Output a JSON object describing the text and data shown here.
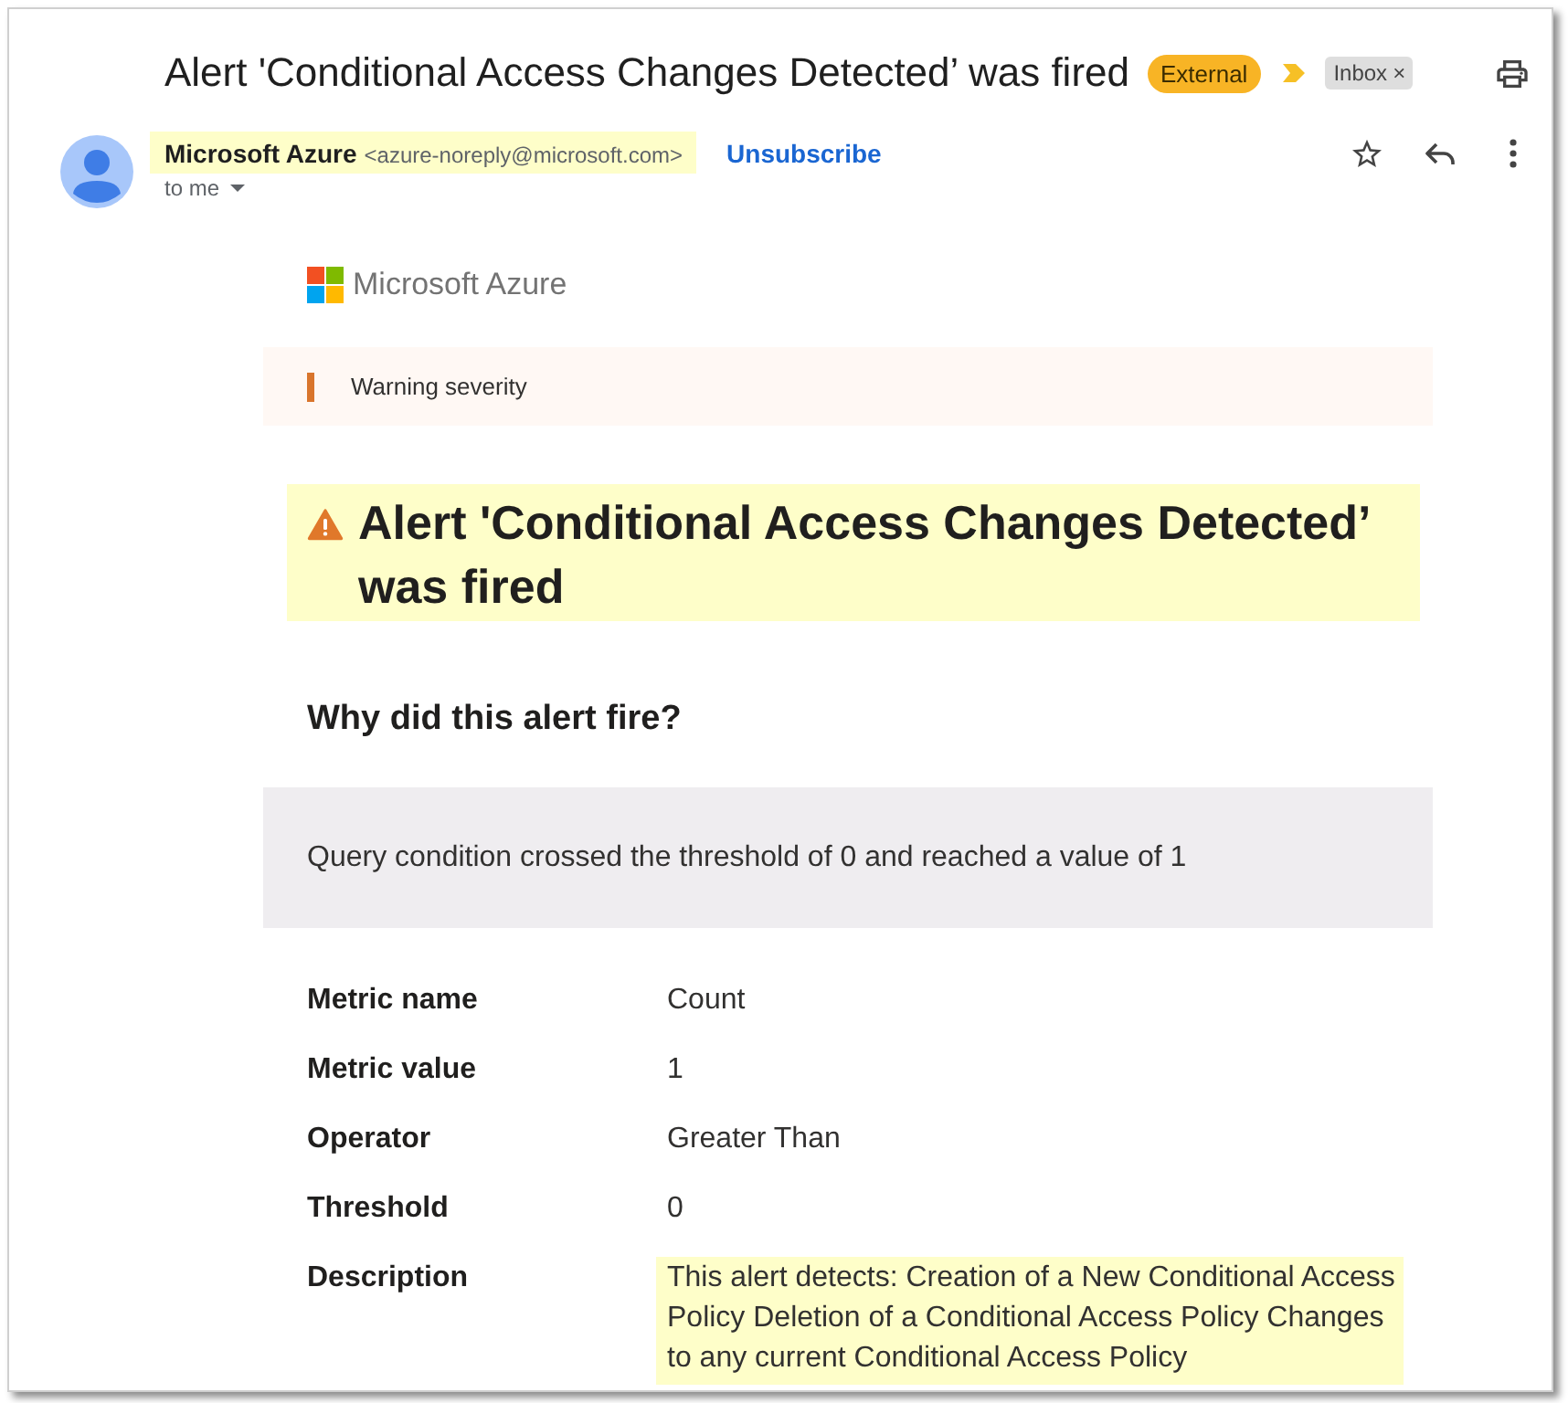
{
  "subject": {
    "title": "Alert 'Conditional Access Changes Detected’ was fired",
    "external_badge": "External",
    "important": true,
    "label_chip": {
      "text": "Inbox",
      "remove": "×"
    }
  },
  "sender": {
    "name": "Microsoft Azure",
    "address": "<azure-noreply@microsoft.com>",
    "highlighted": true,
    "unsubscribe": "Unsubscribe",
    "recipient": "to me"
  },
  "message": {
    "brand": "Microsoft Azure",
    "severity": {
      "kind": "warning",
      "text": "Warning severity"
    },
    "alert_title": {
      "text": "Alert 'Conditional Access Changes Detected’ was fired",
      "highlighted": true
    },
    "why_heading": "Why did this alert fire?",
    "condition": "Query condition crossed the threshold of 0 and reached a value of 1",
    "details": [
      {
        "label": "Metric name",
        "value": "Count",
        "highlighted": false
      },
      {
        "label": "Metric value",
        "value": "1",
        "highlighted": false
      },
      {
        "label": "Operator",
        "value": "Greater Than",
        "highlighted": false
      },
      {
        "label": "Threshold",
        "value": "0",
        "highlighted": false
      },
      {
        "label": "Description",
        "value": "This alert detects: Creation of a New Conditional Access Policy Deletion of a Conditional Access Policy Changes to any current Conditional Access Policy",
        "highlighted": true
      }
    ]
  }
}
